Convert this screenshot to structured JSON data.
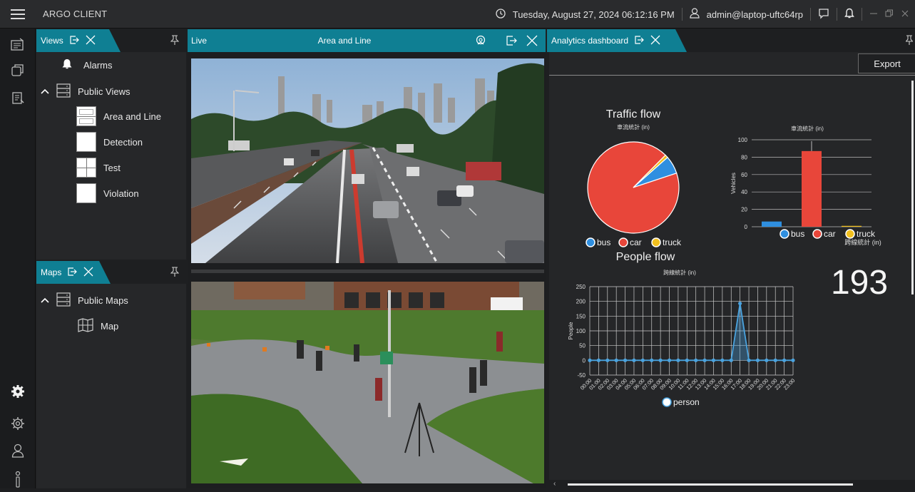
{
  "app": {
    "title": "ARGO CLIENT"
  },
  "titlebar": {
    "datetime": "Tuesday, August 27, 2024 06:12:16 PM",
    "user": "admin@laptop-uftc64rp"
  },
  "views_panel": {
    "tab_label": "Views",
    "alarms_label": "Alarms",
    "public_views_label": "Public Views",
    "items": [
      {
        "label": "Area and Line",
        "layout": "split-2h"
      },
      {
        "label": "Detection",
        "layout": "single"
      },
      {
        "label": "Test",
        "layout": "quad"
      },
      {
        "label": "Violation",
        "layout": "single"
      }
    ]
  },
  "maps_panel": {
    "tab_label": "Maps",
    "public_maps_label": "Public Maps",
    "items": [
      {
        "label": "Map"
      }
    ]
  },
  "live_panel": {
    "tab_label": "Live",
    "view_title": "Area and Line"
  },
  "dashboard": {
    "tab_label": "Analytics dashboard",
    "export_label": "Export",
    "traffic_title": "Traffic flow",
    "people_title": "People flow",
    "counter_subtitle": "跨線統計 (in)",
    "counter_value": "193"
  },
  "colors": {
    "accent": "#0f7f93",
    "bus": "#2f8fe0",
    "car": "#e8463a",
    "truck": "#f2c01e",
    "person": "#4aa3df"
  },
  "chart_data": [
    {
      "type": "pie",
      "title": "Traffic flow",
      "subtitle": "車流統計 (in)",
      "categories": [
        "bus",
        "car",
        "truck"
      ],
      "values": [
        6,
        87,
        1
      ]
    },
    {
      "type": "bar",
      "subtitle": "車流統計 (in)",
      "ylabel": "Vehicles",
      "ylim": [
        0,
        100
      ],
      "yticks": [
        0,
        20,
        40,
        60,
        80,
        100
      ],
      "categories": [
        "bus",
        "car",
        "truck"
      ],
      "values": [
        6,
        87,
        1
      ]
    },
    {
      "type": "line",
      "title": "People flow",
      "subtitle": "跨線統計 (in)",
      "ylabel": "People",
      "ylim": [
        -50,
        250
      ],
      "yticks": [
        -50,
        0,
        50,
        100,
        150,
        200,
        250
      ],
      "x": [
        "00:00",
        "01:00",
        "02:00",
        "03:00",
        "04:00",
        "05:00",
        "06:00",
        "07:00",
        "08:00",
        "09:00",
        "10:00",
        "11:00",
        "12:00",
        "13:00",
        "14:00",
        "15:00",
        "16:00",
        "17:00",
        "18:00",
        "19:00",
        "20:00",
        "21:00",
        "22:00",
        "23:00"
      ],
      "series": [
        {
          "name": "person",
          "values": [
            0,
            0,
            0,
            0,
            0,
            0,
            0,
            0,
            0,
            0,
            0,
            0,
            0,
            0,
            0,
            0,
            0,
            193,
            0,
            0,
            0,
            0,
            0,
            0
          ]
        }
      ]
    }
  ]
}
